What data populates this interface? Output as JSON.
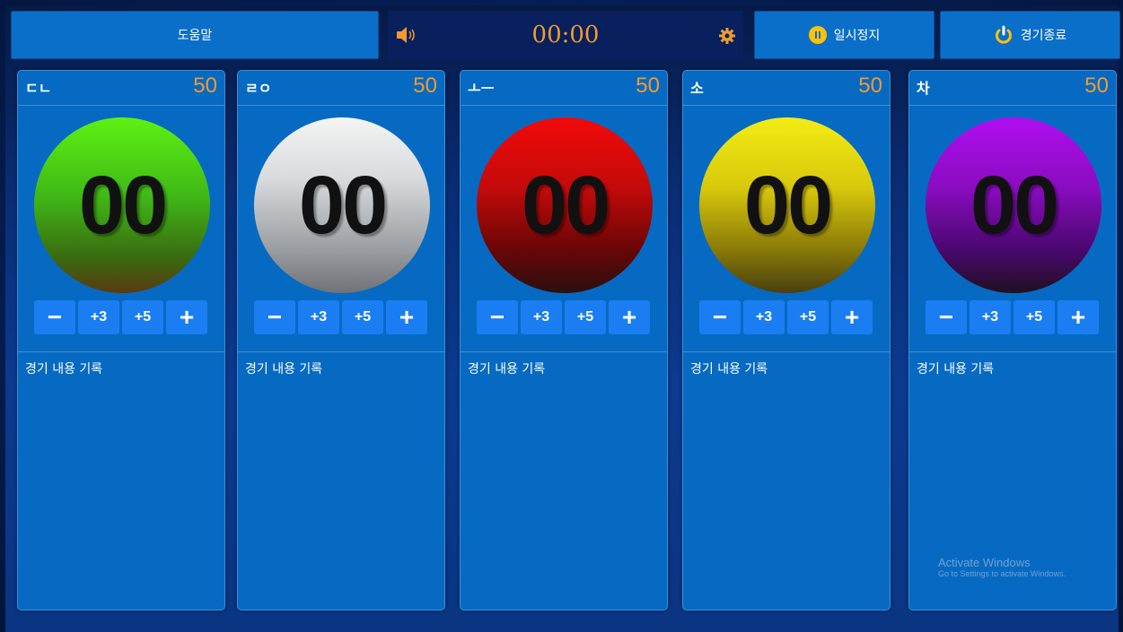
{
  "header": {
    "help_label": "도움말",
    "timer": "00:00",
    "pause_label": "일시정지",
    "end_label": "경기종료"
  },
  "colors": {
    "accent_orange": "#f29a2e",
    "button_blue": "#0a6fc9",
    "panel_blue": "#066ac3"
  },
  "players": [
    {
      "name": "ㄷㄴ",
      "target": "50",
      "score": "00",
      "ball_color": "green",
      "controls": [
        "−",
        "+3",
        "+5",
        "+"
      ],
      "log_label": "경기 내용 기록"
    },
    {
      "name": "ㄹㅇ",
      "target": "50",
      "score": "00",
      "ball_color": "white",
      "controls": [
        "−",
        "+3",
        "+5",
        "+"
      ],
      "log_label": "경기 내용 기록"
    },
    {
      "name": "ㅗㅡ",
      "target": "50",
      "score": "00",
      "ball_color": "red",
      "controls": [
        "−",
        "+3",
        "+5",
        "+"
      ],
      "log_label": "경기 내용 기록"
    },
    {
      "name": "소",
      "target": "50",
      "score": "00",
      "ball_color": "yellow",
      "controls": [
        "−",
        "+3",
        "+5",
        "+"
      ],
      "log_label": "경기 내용 기록"
    },
    {
      "name": "차",
      "target": "50",
      "score": "00",
      "ball_color": "purple",
      "controls": [
        "−",
        "+3",
        "+5",
        "+"
      ],
      "log_label": "경기 내용 기록"
    }
  ],
  "watermark": {
    "title": "Activate Windows",
    "subtitle": "Go to Settings to activate Windows."
  }
}
